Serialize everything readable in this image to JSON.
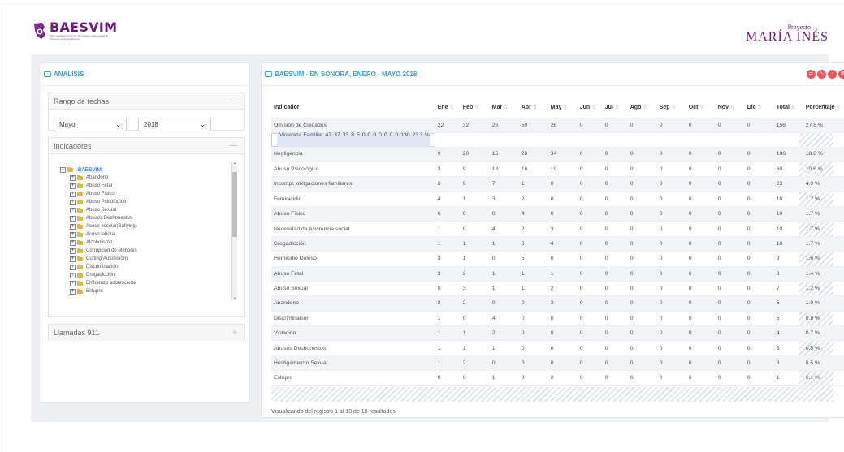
{
  "header": {
    "logo_title": "BAESVIM",
    "logo_subtitle": "Banco Estatal de Datos e Información sobre Casos de Violencia contra las Mujeres",
    "brand_small": "Proyecto",
    "brand_big": "MARÍA INÉS"
  },
  "left_panel": {
    "title": "ANALISIS",
    "date_section": {
      "title": "Rango de fechas",
      "toggle": "—",
      "month_value": "Mayo",
      "year_value": "2018"
    },
    "indicators_section": {
      "title": "Indicadores",
      "toggle": "—",
      "root_label": "BAESVIM",
      "items": [
        "Abandono",
        "Abuso Fetal",
        "Abuso Físico",
        "Abuso Psicológico",
        "Abuso Sexual",
        "Abusos Deshonestos",
        "Acoso escolar(Bullying)",
        "Acoso laboral",
        "Alcoholismo",
        "Corrupción de Menores",
        "Cutting(Autolesión)",
        "Discriminación",
        "Drogadicción",
        "Embarazo adolescente",
        "Estupro"
      ]
    },
    "calls_section": {
      "title": "Llamadas 911",
      "toggle": "+"
    }
  },
  "right_panel": {
    "title": "BAESVIM - EN SONORA, ENERO - MAYO 2018",
    "tools": [
      "table-icon",
      "chart-icon",
      "pie-icon",
      "export-icon"
    ],
    "columns": [
      "Indicador",
      "Ene",
      "Feb",
      "Mar",
      "Abr",
      "May",
      "Jun",
      "Jul",
      "Ago",
      "Sep",
      "Oct",
      "Nov",
      "Dic",
      "Total",
      "Porcentaje"
    ],
    "rows": [
      [
        "Omisión de Cuidados",
        "22",
        "32",
        "26",
        "50",
        "26",
        "0",
        "0",
        "0",
        "0",
        "0",
        "0",
        "0",
        "156",
        "27.8 %"
      ],
      [
        "Violencia Familiar",
        "47",
        "37",
        "33",
        "8",
        "5",
        "0",
        "0",
        "0",
        "0",
        "0",
        "0",
        "0",
        "130",
        "23.1 %"
      ],
      [
        "Negligencia",
        "9",
        "20",
        "15",
        "28",
        "34",
        "0",
        "0",
        "0",
        "0",
        "0",
        "0",
        "0",
        "106",
        "18.8 %"
      ],
      [
        "Abuso Psicológico",
        "3",
        "9",
        "13",
        "16",
        "19",
        "0",
        "0",
        "0",
        "0",
        "0",
        "0",
        "0",
        "60",
        "10.6 %"
      ],
      [
        "Incumpl. obligaciones familiares",
        "6",
        "9",
        "7",
        "1",
        "0",
        "0",
        "0",
        "0",
        "0",
        "0",
        "0",
        "0",
        "23",
        "4.0 %"
      ],
      [
        "Feminicidio",
        "4",
        "1",
        "3",
        "2",
        "0",
        "0",
        "0",
        "0",
        "0",
        "0",
        "0",
        "0",
        "10",
        "1.7 %"
      ],
      [
        "Abuso Físico",
        "6",
        "0",
        "0",
        "4",
        "0",
        "0",
        "0",
        "0",
        "0",
        "0",
        "0",
        "0",
        "10",
        "1.7 %"
      ],
      [
        "Necesidad de Asistencia social",
        "1",
        "0",
        "4",
        "2",
        "3",
        "0",
        "0",
        "0",
        "0",
        "0",
        "0",
        "0",
        "10",
        "1.7 %"
      ],
      [
        "Drogadicción",
        "1",
        "1",
        "1",
        "3",
        "4",
        "0",
        "0",
        "0",
        "0",
        "0",
        "0",
        "0",
        "10",
        "1.7 %"
      ],
      [
        "Homicidio Doloso",
        "3",
        "1",
        "0",
        "5",
        "0",
        "0",
        "0",
        "0",
        "0",
        "0",
        "0",
        "0",
        "9",
        "1.6 %"
      ],
      [
        "Abuso Fetal",
        "3",
        "2",
        "1",
        "1",
        "1",
        "0",
        "0",
        "0",
        "0",
        "0",
        "0",
        "0",
        "8",
        "1.4 %"
      ],
      [
        "Abuso Sexual",
        "0",
        "3",
        "1",
        "1",
        "2",
        "0",
        "0",
        "0",
        "0",
        "0",
        "0",
        "0",
        "7",
        "1.2 %"
      ],
      [
        "Abandono",
        "2",
        "2",
        "0",
        "0",
        "2",
        "0",
        "0",
        "0",
        "0",
        "0",
        "0",
        "0",
        "6",
        "1.0 %"
      ],
      [
        "Discriminación",
        "1",
        "0",
        "4",
        "0",
        "0",
        "0",
        "0",
        "0",
        "0",
        "0",
        "0",
        "0",
        "5",
        "0.8 %"
      ],
      [
        "Violación",
        "1",
        "1",
        "2",
        "0",
        "0",
        "0",
        "0",
        "0",
        "0",
        "0",
        "0",
        "0",
        "4",
        "0.7 %"
      ],
      [
        "Abusos Deshonestos",
        "1",
        "1",
        "1",
        "0",
        "0",
        "0",
        "0",
        "0",
        "0",
        "0",
        "0",
        "0",
        "3",
        "0.5 %"
      ],
      [
        "Hostigamiento Sexual",
        "1",
        "2",
        "0",
        "0",
        "0",
        "0",
        "0",
        "0",
        "0",
        "0",
        "0",
        "0",
        "3",
        "0.5 %"
      ],
      [
        "Estupro",
        "0",
        "0",
        "1",
        "0",
        "0",
        "0",
        "0",
        "0",
        "0",
        "0",
        "0",
        "0",
        "1",
        "0.1 %"
      ]
    ],
    "footer_info": "Visualizando del registro 1 al 18 de 18 resultados"
  },
  "colors": {
    "accent": "#3ba3c7",
    "brand": "#6a1b7a",
    "tool_red": "#f0545b",
    "stage_bg": "#eef0f3"
  }
}
